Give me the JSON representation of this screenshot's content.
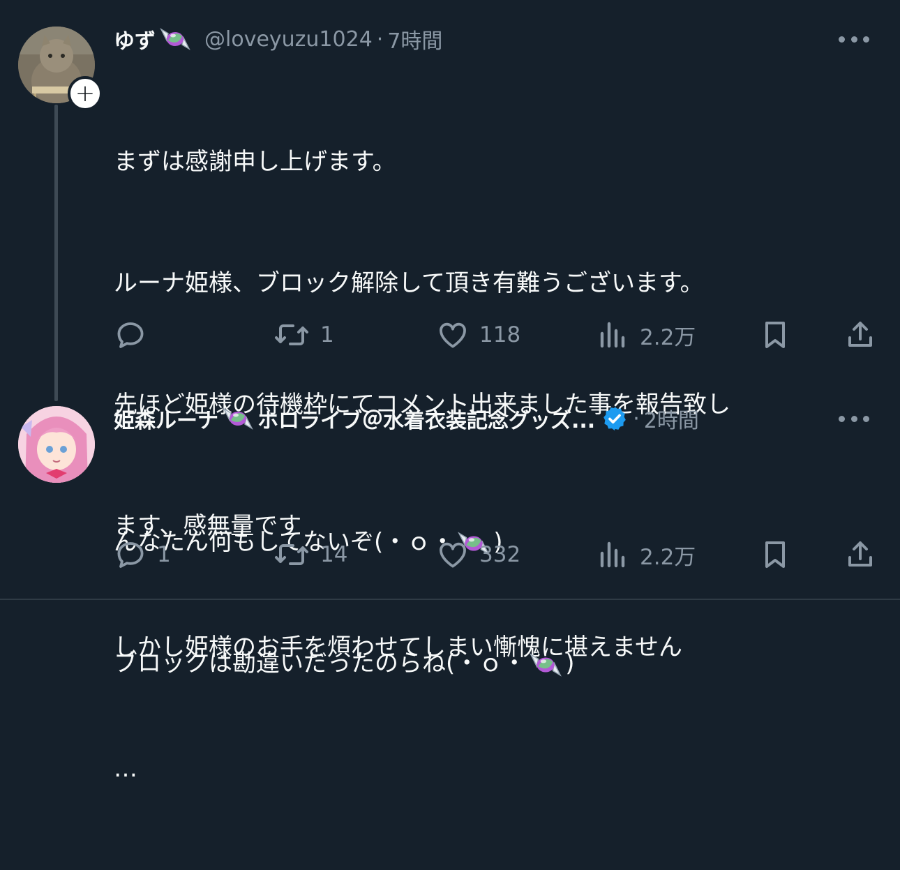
{
  "tweets": [
    {
      "name": "ゆず",
      "handle": "@loveyuzu1024",
      "time": "7時間",
      "lines": [
        "まずは感謝申し上げます。",
        "ルーナ姫様、ブロック解除して頂き有難うございます。",
        "先ほど姫様の待機枠にてコメント出来ました事を報告致し",
        "ます、感無量です",
        "しかし姫様のお手を煩わせてしまい慚愧に堪えません",
        "…"
      ],
      "replies": "",
      "retweets": "1",
      "likes": "118",
      "views": "2.2万"
    },
    {
      "name": "姫森ルーナ",
      "name_suffix": "ホロライブ＠水着衣装記念グッズ...",
      "time": "2時間",
      "lines_a": [
        "んなたん何もしてないぞ(・ｏ・",
        "ブロックは勘違いだったのらね(・ｏ・"
      ],
      "replies": "1",
      "retweets": "14",
      "likes": "332",
      "views": "2.2万"
    }
  ],
  "separator": "·",
  "follow_symbol": "+",
  "icons": {
    "reply": "reply-icon",
    "retweet": "retweet-icon",
    "like": "heart-icon",
    "views": "views-icon",
    "bookmark": "bookmark-icon",
    "share": "share-icon",
    "more": "more-icon",
    "verified": "verified-badge-icon",
    "candy": "candy-emoji-icon"
  },
  "colors": {
    "background": "#15202b",
    "text": "#f7f9f9",
    "muted": "#8b98a5",
    "verified": "#1d9bf0"
  }
}
